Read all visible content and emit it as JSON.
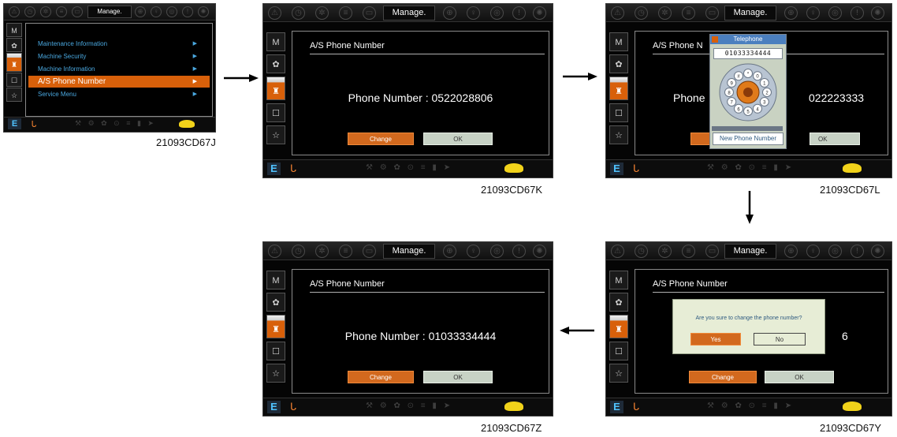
{
  "topbar": {
    "title": "Manage.",
    "icons": [
      "warning-icon",
      "filter-icon",
      "sprocket-icon",
      "grid-icon",
      "battery-icon",
      "fuel-icon",
      "thermometer-icon",
      "coolant-icon",
      "alert-circle-icon",
      "gear-icon"
    ]
  },
  "side_menu": [
    {
      "label": "M",
      "icon": "m-icon"
    },
    {
      "label": "✿",
      "icon": "gear-icon"
    },
    {
      "label": "♜",
      "icon": "person-icon"
    },
    {
      "label": "☐",
      "icon": "tv-icon"
    },
    {
      "label": "☆",
      "icon": "star-icon"
    }
  ],
  "bottom_bar": {
    "e_label": "E",
    "crane_glyph": "ᒐ",
    "icons_glyphs": "⚒ ⚙ ✿ ⊙ ≡ ▮ ➤",
    "turtle_icon": "turtle-icon"
  },
  "screen1": {
    "menu": [
      {
        "label": "Maintenance Information",
        "arrow": "▶"
      },
      {
        "label": "Machine Security",
        "arrow": "▶"
      },
      {
        "label": "Machine Information",
        "arrow": "▶"
      },
      {
        "label": "A/S Phone Number",
        "arrow": "▶",
        "selected": true
      },
      {
        "label": "Service Menu",
        "arrow": "▶"
      }
    ],
    "caption": "21093CD67J"
  },
  "screen2": {
    "title": "A/S Phone Number",
    "phone_text": "Phone Number : 0522028806",
    "change_label": "Change",
    "ok_label": "OK",
    "caption": "21093CD67K"
  },
  "screen3": {
    "title": "A/S Phone N",
    "phone_text_left": "Phone",
    "phone_text_right": "022223333",
    "telephone_title": "Telephone",
    "telephone_number": "01033334444",
    "dial_digits": [
      "*",
      "0",
      "1",
      "2",
      "3",
      "4",
      "5",
      "6",
      "7",
      "8",
      "9",
      "#"
    ],
    "new_phone_label": "New Phone Number",
    "ok_label": "OK",
    "caption": "21093CD67L"
  },
  "screen4": {
    "title": "A/S Phone Number",
    "dialog_text": "Are you sure to change the phone number?",
    "yes_label": "Yes",
    "no_label": "No",
    "phone_tail": "6",
    "change_label": "Change",
    "ok_label": "OK",
    "caption": "21093CD67Y"
  },
  "screen5": {
    "title": "A/S Phone Number",
    "phone_text": "Phone Number : 01033334444",
    "change_label": "Change",
    "ok_label": "OK",
    "caption": "21093CD67Z"
  },
  "colors": {
    "accent_orange": "#d8600a",
    "menu_blue": "#4aa8e0",
    "ok_button": "#c7d2c5",
    "turtle_yellow": "#f1d21a"
  }
}
